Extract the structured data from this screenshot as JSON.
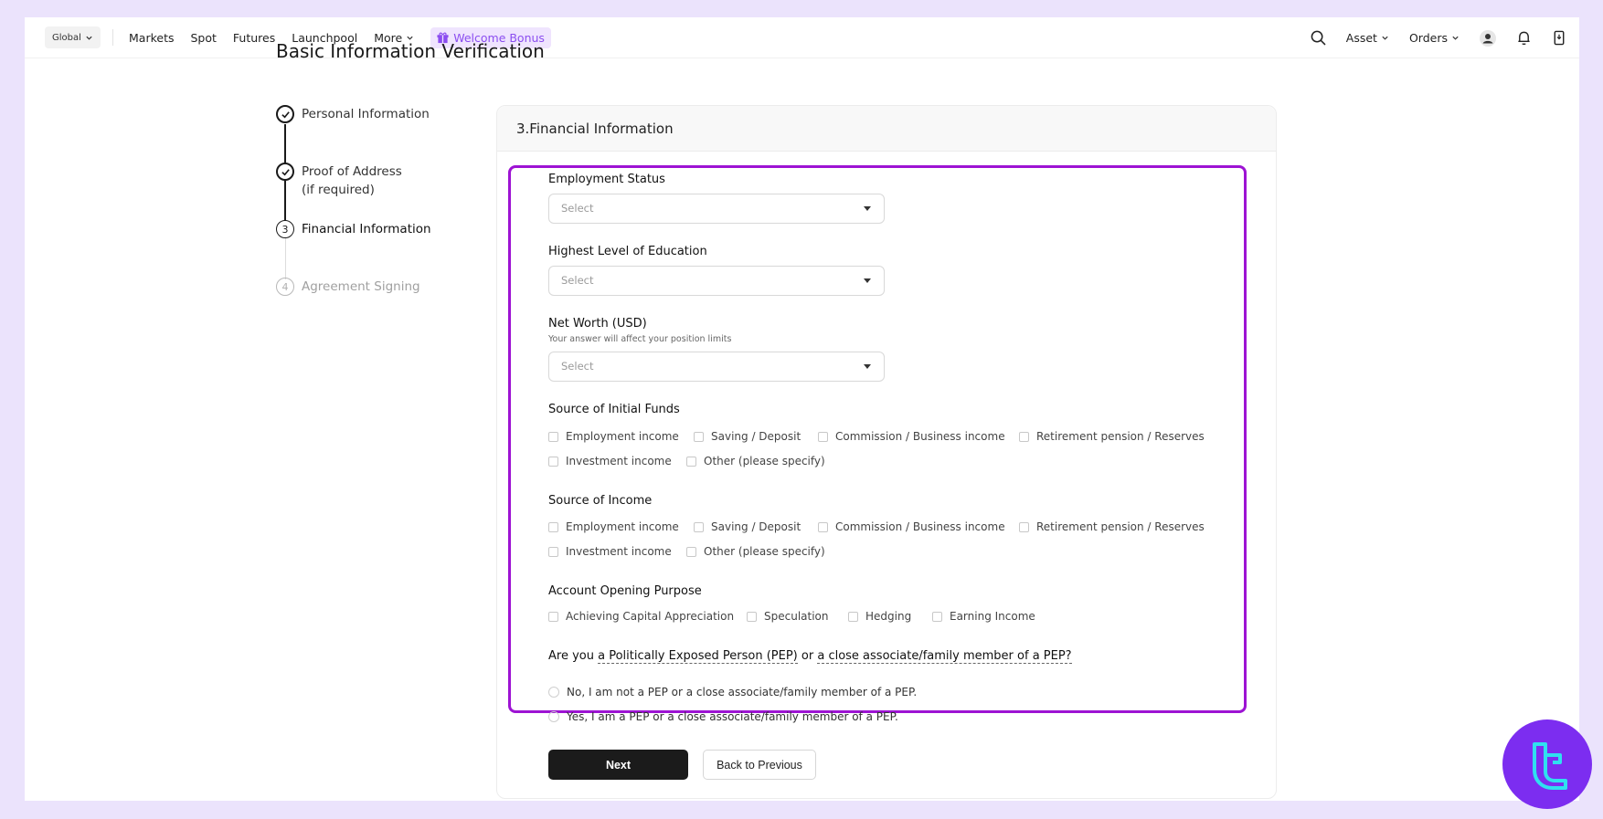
{
  "nav": {
    "region": "Global",
    "links": [
      "Markets",
      "Spot",
      "Futures",
      "Launchpool",
      "More"
    ],
    "bonus": "Welcome Bonus",
    "right": {
      "asset": "Asset",
      "orders": "Orders"
    }
  },
  "page_title": "Basic Information Verification",
  "steps": [
    {
      "label": "Personal Information",
      "status": "done"
    },
    {
      "label": "Proof of Address",
      "label2": "(if required)",
      "status": "done"
    },
    {
      "label": "Financial Information",
      "number": "3",
      "status": "active"
    },
    {
      "label": "Agreement Signing",
      "number": "4",
      "status": "pending"
    }
  ],
  "card_title": "3.Financial Information",
  "form": {
    "employment_status": {
      "label": "Employment Status",
      "placeholder": "Select"
    },
    "education": {
      "label": "Highest Level of Education",
      "placeholder": "Select"
    },
    "net_worth": {
      "label": "Net Worth (USD)",
      "hint": "Your answer will affect your position limits",
      "placeholder": "Select"
    },
    "initial_funds": {
      "label": "Source of Initial Funds",
      "options": [
        "Employment income",
        "Saving / Deposit",
        "Commission / Business income",
        "Retirement pension / Reserves",
        "Investment income",
        "Other (please specify)"
      ]
    },
    "income": {
      "label": "Source of Income",
      "options": [
        "Employment income",
        "Saving / Deposit",
        "Commission / Business income",
        "Retirement pension / Reserves",
        "Investment income",
        "Other (please specify)"
      ]
    },
    "purpose": {
      "label": "Account Opening Purpose",
      "options": [
        "Achieving Capital Appreciation",
        "Speculation",
        "Hedging",
        "Earning Income"
      ]
    },
    "pep": {
      "q_prefix": "Are you ",
      "q_link1": "a Politically Exposed Person (PEP)",
      "q_mid": " or ",
      "q_link2": "a close associate/family member of a PEP?",
      "options": [
        "No, I am not a PEP or a close associate/family member of a PEP.",
        "Yes, I am a PEP or a close associate/family member of a PEP."
      ]
    }
  },
  "buttons": {
    "next": "Next",
    "back": "Back to Previous"
  },
  "colors": {
    "highlight": "#9d13d3",
    "bonus_text": "#8b4df0",
    "logo_bg": "#7c2df0",
    "logo_mark": "#2fe0f0"
  }
}
